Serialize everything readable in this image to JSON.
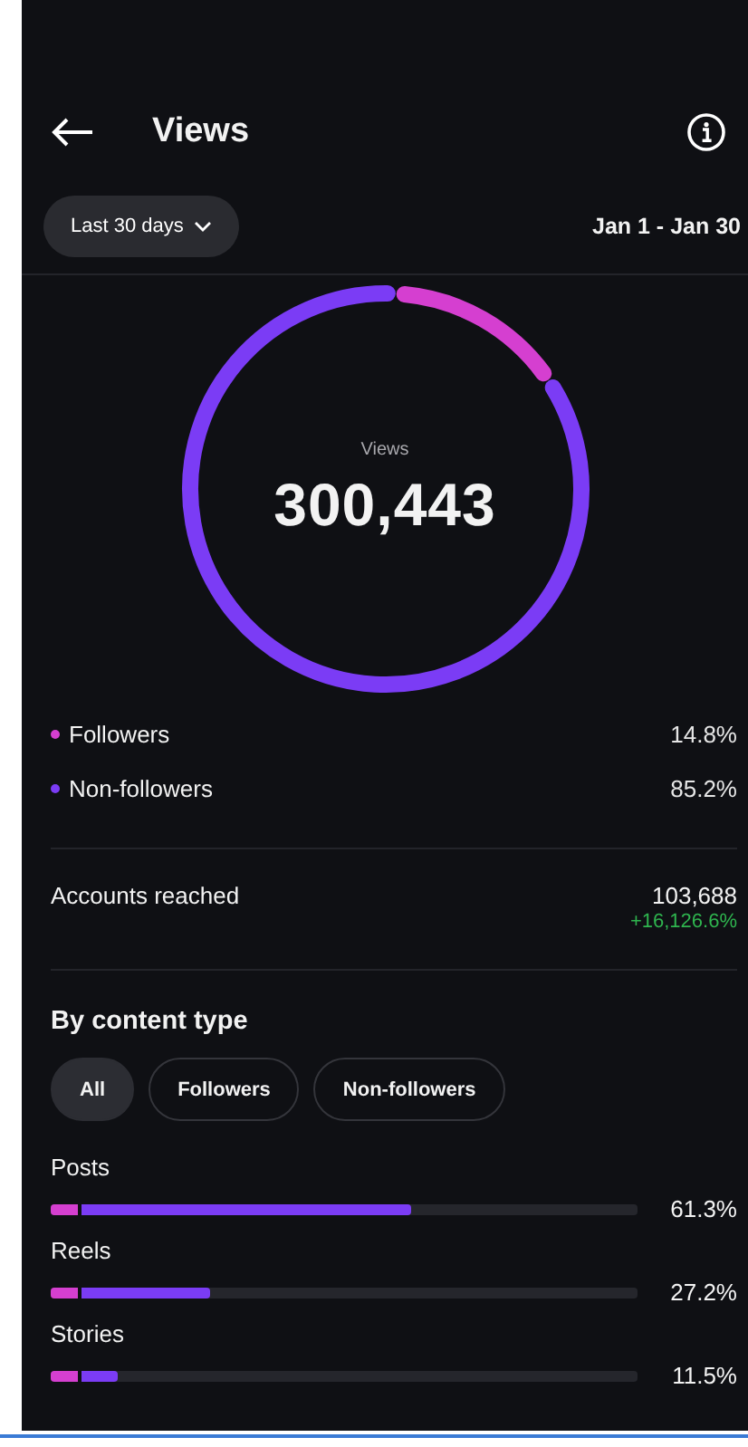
{
  "header": {
    "title": "Views"
  },
  "filter": {
    "period": "Last 30 days",
    "range": "Jan 1 - Jan 30"
  },
  "ring": {
    "label": "Views",
    "total": "300,443"
  },
  "legend": [
    {
      "label": "Followers",
      "value": "14.8%",
      "color": "#d53fd0"
    },
    {
      "label": "Non-followers",
      "value": "85.2%",
      "color": "#7b3cf5"
    }
  ],
  "accounts_reached": {
    "label": "Accounts reached",
    "value": "103,688",
    "change": "+16,126.6%"
  },
  "content_type": {
    "title": "By content type",
    "chips": [
      {
        "label": "All",
        "selected": true
      },
      {
        "label": "Followers",
        "selected": false
      },
      {
        "label": "Non-followers",
        "selected": false
      }
    ],
    "rows": [
      {
        "label": "Posts",
        "level": 0.613,
        "value": "61.3%"
      },
      {
        "label": "Reels",
        "level": 0.272,
        "value": "27.2%"
      },
      {
        "label": "Stories",
        "level": 0.115,
        "value": "11.5%"
      }
    ]
  }
}
